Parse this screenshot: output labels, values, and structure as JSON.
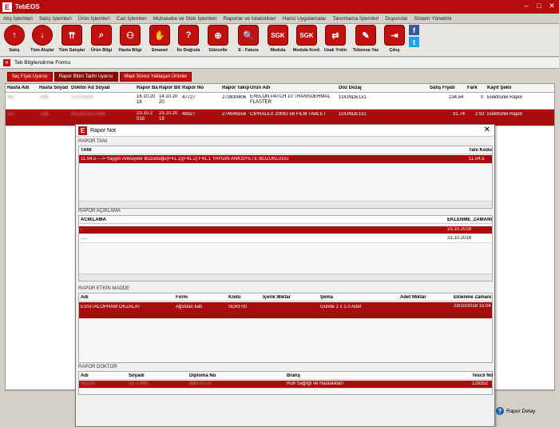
{
  "app": {
    "title": "TebEOS"
  },
  "menu": [
    "Alış İşlemleri",
    "Satış İşlemleri",
    "Ürün İşlemleri",
    "Cari İşlemlen",
    "Muhasebe ve Stok İşlemleri",
    "Raporlar ve İstatistikler",
    "Harici Uygulamalar",
    "Tanımlama İşlemleri",
    "Duyurular",
    "Sistem Yönetimi"
  ],
  "toolbar": [
    {
      "label": "Satış",
      "icon": "arrow-up-icon",
      "glyph": "↑"
    },
    {
      "label": "Tüm Alışlar",
      "icon": "arrow-down-icon",
      "glyph": "↓"
    },
    {
      "label": "Tüm Satışlar",
      "icon": "double-arrow-up-icon",
      "glyph": "⇈"
    },
    {
      "label": "Ürün Bilgi",
      "icon": "magnifier-icon",
      "glyph": "⌕"
    },
    {
      "label": "Hasta Bilgi",
      "icon": "patients-icon",
      "glyph": "⚇"
    },
    {
      "label": "Emanet",
      "icon": "hand-icon",
      "glyph": "✋"
    },
    {
      "label": "İts Doğrula",
      "icon": "question-icon",
      "glyph": "?"
    },
    {
      "label": "Güncelle",
      "icon": "globe-icon",
      "glyph": "⊕"
    },
    {
      "label": "E - Fatura",
      "icon": "e-invoice-icon",
      "glyph": "🔍"
    },
    {
      "label": "Medula",
      "icon": "sgk-medula-icon",
      "glyph": "SGK"
    },
    {
      "label": "Medula Konf.",
      "icon": "sgk-config-icon",
      "glyph": "SGK"
    },
    {
      "label": "Uzak Yrdm",
      "icon": "remote-help-icon",
      "glyph": "⇄"
    },
    {
      "label": "Tebeosa Yaz",
      "icon": "write-icon",
      "glyph": "✎"
    },
    {
      "label": "Çıkış",
      "icon": "exit-icon",
      "glyph": "⇥"
    }
  ],
  "social": {
    "facebook": "f",
    "twitter": "t"
  },
  "form": {
    "tab_title": "Teb Bilgilendirme Formu"
  },
  "subtabs": [
    "İlaç Fiyat Uyarısı",
    "Rapor Bitim Tarihi Uyarısı",
    "Miad Süresi Yaklaşan Ürünler"
  ],
  "grid": {
    "columns": [
      "Hasta Adı",
      "Hasta Soyad",
      "Doktor Ad Soyad",
      "Rapor Ba",
      "Rapor Bit",
      "Rapor No",
      "Rapor Takip",
      "Ürün Adı",
      "Doz Dozaj",
      "Satış Fiyatı",
      "Fark",
      "Kayıt Şekli"
    ],
    "rows": [
      {
        "hasta_adi": "ALİ",
        "hasta_soyad": "TOK",
        "doktor": "S.UYGUN",
        "baslangic": "16.10.20 18",
        "bitis": "14.10.20 20",
        "rapor_no": "47727",
        "takip": "273830406",
        "urun": "EXELON PATCH 10 TRANSDERMAL FLASTER",
        "doz": "1GUNDE1x1",
        "fiyat": "234.54",
        "fark": "0",
        "kayit": "Elektronik Rapor"
      },
      {
        "hasta_adi": "ALİ",
        "hasta_soyad": "TOK",
        "doktor": "PELİN ÖZTÜRK",
        "baslangic": "23.10.2 018",
        "bitis": "23.10.20 19",
        "rapor_no": "48327",
        "takip": "274646556",
        "urun": "CIPRALEX 20MG 56 FILM TABLET",
        "doz": "1GUNDE1x1",
        "fiyat": "31.74",
        "fark": "2.92",
        "kayit": "Elektronik Rapor"
      }
    ]
  },
  "rapor_detay": "Rapor Detay",
  "dialog": {
    "title": "Rapor Not",
    "tani": {
      "section": "RAPOR TANI",
      "cols": [
        "TANI",
        "Tanı Kodu"
      ],
      "rows": [
        {
          "tani": "11.04.5 ---> Yaygın Anksiyete Bozukluğu(F41.1)(F41.2) F41.1 YAYGIN ANKSİYETE BOZUKLUĞU",
          "kod": "11.04.5"
        }
      ]
    },
    "aciklama": {
      "section": "RAPOR AÇIKLAMA",
      "cols": [
        "ACIKLAMA",
        "EKLENME_ZAMANI"
      ],
      "rows": [
        {
          "aciklama": "-",
          "zaman": "23.10.2018"
        },
        {
          "aciklama": ".....",
          "zaman": "23.10.2018"
        }
      ]
    },
    "etkin": {
      "section": "RAPOR ETKİN MADDE",
      "cols": [
        "Adı",
        "Form",
        "Kodu",
        "İçerik Miktar",
        "Şema",
        "Adet Miktar",
        "Eklenme Zamanı"
      ],
      "rows": [
        {
          "adi": "ESSITALOPRAM OKZALAT",
          "form": "Ağızdan katı",
          "kodu": "SGKF00",
          "icerik": "",
          "sema": "Günde 1 x 1.0 Adet",
          "adet": "",
          "zaman": "23/10/2018 15:04"
        }
      ]
    },
    "doktor": {
      "section": "RAPOR DOKTOR",
      "cols": [
        "Adı",
        "Soyadı",
        "Diploma No",
        "Branş",
        "Tescil No"
      ],
      "rows": [
        {
          "adi": "PELİN",
          "soyadi": "ÖZTÜRK",
          "diploma": "98874-1-6",
          "brans": "Ruh Sağlığı ve Hastalıkları",
          "tescil": "129352"
        }
      ]
    }
  }
}
